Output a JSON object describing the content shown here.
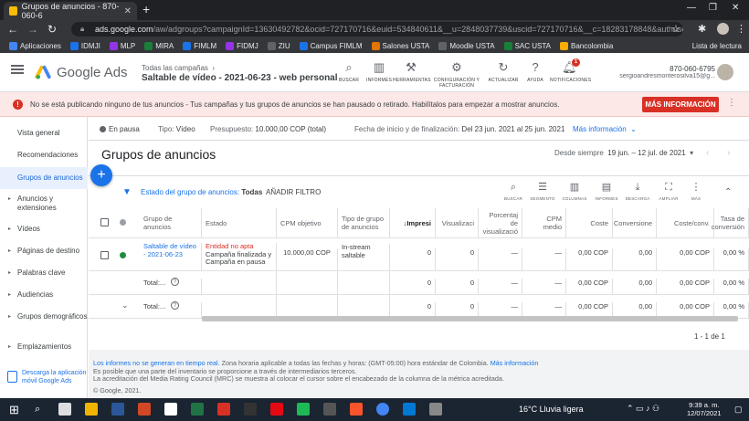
{
  "browser": {
    "tab_title": "Grupos de anuncios - 870-060-6",
    "url_host": "ads.google.com",
    "url_path": "/aw/adgroups?campaignId=13630492782&ocid=727170716&euid=534840611&__u=2848037739&uscid=727170716&__c=18283178848&authuser=0&...",
    "bookmarks": [
      "Aplicaciones",
      "IDMJI",
      "MLP",
      "MIRA",
      "FIMLM",
      "FIDMJ",
      "ZIU",
      "Campus FIMLM",
      "Salones USTA",
      "Moodle USTA",
      "SAC USTA",
      "Bancolombia"
    ],
    "reading_list": "Lista de lectura"
  },
  "header": {
    "product": "Google Ads",
    "crumb": "Todas las campañas",
    "campaign": "Saltable de vídeo - 2021-06-23 - web personal",
    "tools": [
      {
        "icon": "search-icon",
        "label": "BUSCAR"
      },
      {
        "icon": "reports-icon",
        "label": "INFORMES"
      },
      {
        "icon": "wrench-icon",
        "label": "HERRAMIENTAS"
      },
      {
        "icon": "gear-icon",
        "label": "CONFIGURACIÓN Y FACTURACIÓN"
      },
      {
        "icon": "refresh-icon",
        "label": "ACTUALIZAR"
      },
      {
        "icon": "help-icon",
        "label": "AYUDA"
      },
      {
        "icon": "bell-icon",
        "label": "NOTIFICACIONES"
      }
    ],
    "notification_count": "1",
    "account_id": "870-060-6795",
    "account_email": "sergioandresmonterosilva15@g..."
  },
  "alert": {
    "bold": "No se está publicando ninguno de tus anuncios",
    "text": " - Tus campañas y tus grupos de anuncios se han pausado o retirado. Habilítalos para empezar a mostrar anuncios.",
    "button": "MÁS INFORMACIÓN"
  },
  "sidebar": {
    "items": [
      {
        "label": "Vista general",
        "caret": false
      },
      {
        "label": "Recomendaciones",
        "caret": false
      },
      {
        "label": "Grupos de anuncios",
        "caret": false
      },
      {
        "label": "Anuncios y extensiones",
        "caret": true
      },
      {
        "label": "Vídeos",
        "caret": true
      },
      {
        "label": "Páginas de destino",
        "caret": true
      },
      {
        "label": "Palabras clave",
        "caret": true
      },
      {
        "label": "Audiencias",
        "caret": true
      },
      {
        "label": "Grupos demográficos",
        "caret": true
      },
      {
        "label": "Emplazamientos",
        "caret": true
      }
    ],
    "download": "Descarga la aplicación móvil Google Ads"
  },
  "status": {
    "state": "En pausa",
    "type_label": "Tipo:",
    "type_value": "Vídeo",
    "budget_label": "Presupuesto:",
    "budget_value": "10.000,00 COP (total)",
    "dates_label": "Fecha de inicio y de finalización:",
    "dates_value": "Del 23 jun. 2021 al 25 jun. 2021",
    "more": "Más información"
  },
  "page": {
    "title": "Grupos de anuncios",
    "range_label": "Desde siempre",
    "range_value": "19 jun. – 12 jul. de 2021"
  },
  "filter": {
    "label": "Estado del grupo de anuncios:",
    "value": "Todas",
    "add": "AÑADIR FILTRO",
    "tools": [
      {
        "icon": "search-icon",
        "label": "BUSCAR"
      },
      {
        "icon": "segment-icon",
        "label": "SEGMENTO"
      },
      {
        "icon": "columns-icon",
        "label": "COLUMNAS"
      },
      {
        "icon": "reports-icon",
        "label": "INFORMES"
      },
      {
        "icon": "download-icon",
        "label": "DESCARGA"
      },
      {
        "icon": "expand-icon",
        "label": "AMPLIAR"
      },
      {
        "icon": "more-icon",
        "label": "MÁS"
      }
    ]
  },
  "table": {
    "headers": [
      "Grupo de anuncios",
      "Estado",
      "CPM objetivo",
      "Tipo de grupo de anuncios",
      "Impresi",
      "Visualizaci",
      "Porcentaj de visualizació",
      "CPM medio",
      "Coste",
      "Conversione",
      "Coste/conv.",
      "Tasa de conversión"
    ],
    "row": {
      "name": "Saltable de vídeo - 2021-06-23",
      "status_bad": "Entidad no apta",
      "status_detail": "Campaña finalizada y Campaña en pausa",
      "cpm": "10.000,00 COP",
      "type": "In-stream saltable",
      "impr": "0",
      "views": "0",
      "view_rate": "—",
      "avg_cpm": "—",
      "cost": "0,00 COP",
      "conv": "0,00",
      "cost_conv": "0,00 COP",
      "conv_rate": "0,00 %"
    },
    "total1": {
      "label": "Total:...",
      "impr": "0",
      "views": "0",
      "view_rate": "—",
      "avg_cpm": "—",
      "cost": "0,00 COP",
      "conv": "0,00",
      "cost_conv": "0,00 COP",
      "conv_rate": "0,00 %"
    },
    "total2": {
      "label": "Total:...",
      "impr": "0",
      "views": "0",
      "view_rate": "—",
      "avg_cpm": "—",
      "cost": "0,00 COP",
      "conv": "0,00",
      "cost_conv": "0,00 COP",
      "conv_rate": "0,00 %"
    }
  },
  "pagination": "1 - 1 de 1",
  "footer": {
    "line1a": "Los informes no se generan en tiempo real.",
    "line1b": " Zona horaria aplicable a todas las fechas y horas: (GMT-05:00) hora estándar de Colombia.",
    "line1c": "Más información",
    "line2": "Es posible que una parte del inventario se proporcione a través de intermediarios terceros.",
    "line3": "La acreditación del Media Rating Council (MRC) se muestra al colocar el cursor sobre el encabezado de la columna de la métrica acreditada.",
    "line4": "© Google, 2021."
  },
  "taskbar": {
    "weather": "16°C  Lluvia ligera",
    "time": "9:39 a. m.",
    "date": "12/07/2021"
  }
}
